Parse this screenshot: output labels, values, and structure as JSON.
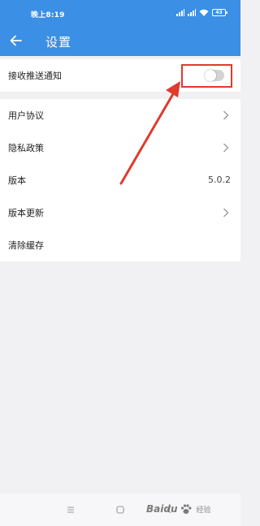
{
  "status_bar": {
    "time": "晚上8:19",
    "battery": "43"
  },
  "header": {
    "title": "设置"
  },
  "settings": {
    "push_label": "接收推送通知",
    "push_enabled": false,
    "user_agreement": "用户协议",
    "privacy_policy": "隐私政策",
    "version_label": "版本",
    "version_value": "5.0.2",
    "version_update": "版本更新",
    "clear_cache": "清除缓存"
  },
  "annotation": {
    "color": "#e03a2e"
  },
  "watermark": {
    "brand": "Baidu",
    "sub": "经验"
  },
  "colors": {
    "header_bg": "#3b8fe4",
    "page_bg": "#f1f1f3"
  }
}
